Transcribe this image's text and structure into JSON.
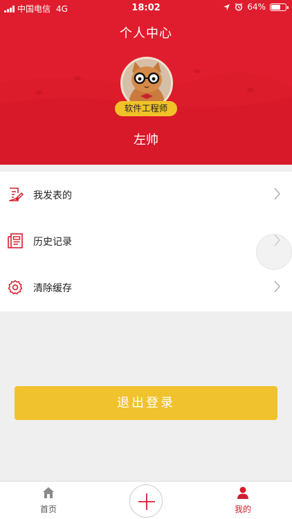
{
  "status_bar": {
    "carrier": "中国电信",
    "network": "4G",
    "time": "18:02",
    "battery": "64%"
  },
  "header": {
    "title": "个人中心",
    "badge": "软件工程师",
    "username": "左帅",
    "bg_color": "#e01d2e"
  },
  "menu": {
    "items": [
      {
        "label": "我发表的",
        "icon": "edit-document-icon"
      },
      {
        "label": "历史记录",
        "icon": "history-document-icon"
      },
      {
        "label": "清除缓存",
        "icon": "settings-gear-icon"
      }
    ]
  },
  "logout": {
    "label": "退出登录",
    "color": "#f0c22e"
  },
  "tabbar": {
    "home_label": "首页",
    "mine_label": "我的",
    "active_color": "#d51c2e"
  }
}
